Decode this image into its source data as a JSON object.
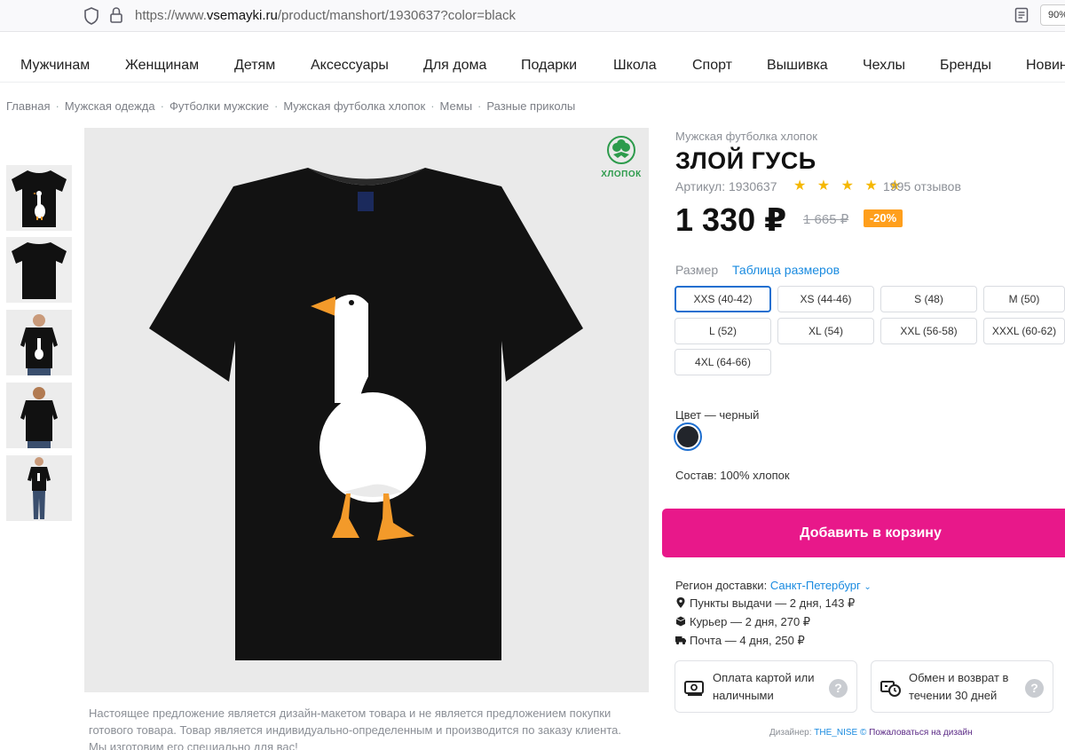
{
  "browser": {
    "url_prefix": "https://www.",
    "url_domain": "vsemayki.ru",
    "url_path": "/product/manshort/1930637?color=black",
    "zoom": "90%"
  },
  "nav": [
    "Мужчинам",
    "Женщинам",
    "Детям",
    "Аксессуары",
    "Для дома",
    "Подарки",
    "Школа",
    "Спорт",
    "Вышивка",
    "Чехлы",
    "Бренды",
    "Новин"
  ],
  "breadcrumbs": [
    "Главная",
    "Мужская одежда",
    "Футболки мужские",
    "Мужская футболка хлопок",
    "Мемы",
    "Разные приколы"
  ],
  "badge": {
    "label": "ХЛОПОК"
  },
  "product": {
    "category": "Мужская футболка хлопок",
    "title": "ЗЛОЙ ГУСЬ",
    "sku": "Артикул: 1930637",
    "rating": 5,
    "stars": "★ ★ ★ ★ ★",
    "reviews": "1995 отзывов",
    "price": "1 330 ₽",
    "old_price": "1 665 ₽",
    "discount": "-20%"
  },
  "sizes": {
    "label": "Размер",
    "chart_link": "Таблица размеров",
    "options": [
      "XXS (40-42)",
      "XS (44-46)",
      "S (48)",
      "M (50)",
      "L (52)",
      "XL (54)",
      "XXL (56-58)",
      "XXXL (60-62)",
      "4XL (64-66)"
    ],
    "selected": "XXS (40-42)"
  },
  "color": {
    "label": "Цвет — черный",
    "swatch": "#22252b"
  },
  "composition": "Состав: 100% хлопок",
  "cart_button": "Добавить в корзину",
  "delivery": {
    "region_label": "Регион доставки:",
    "city": "Санкт-Петербург",
    "lines": [
      "Пункты выдачи — 2 дня, 143 ₽",
      "Курьер — 2 дня, 270 ₽",
      "Почта — 4 дня, 250 ₽"
    ]
  },
  "info": {
    "payment": "Оплата картой или наличными",
    "returns": "Обмен и возврат в течении 30 дней",
    "help": "?"
  },
  "designer": {
    "prefix": "Дизайнер:",
    "name": "THE_NISE",
    "copyright": "©",
    "report": "Пожаловаться на дизайн"
  },
  "disclaimer": "Настоящее предложение является дизайн-макетом товара и не является предложением покупки готового товара. Товар является индивидуально-определенным и производится по заказу клиента. Мы изготовим его специально для вас!",
  "colors": {
    "accent_pink": "#e8188a",
    "link_blue": "#1a8be0",
    "discount_orange": "#ff9f1c",
    "star_yellow": "#f5b800"
  }
}
